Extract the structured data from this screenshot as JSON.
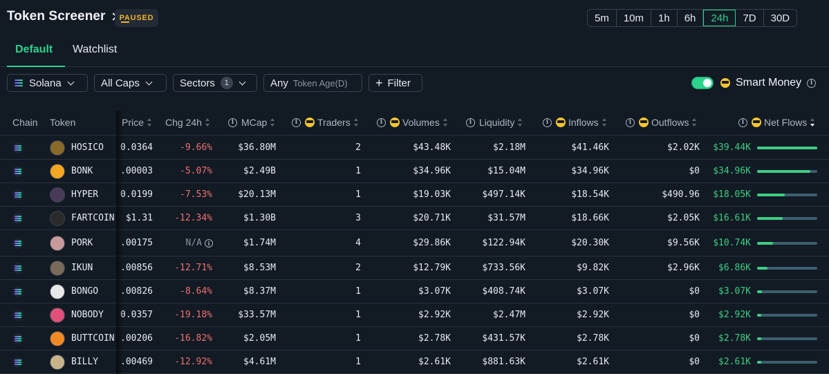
{
  "header": {
    "title": "Token Screener",
    "status_badge": "PAUSED"
  },
  "timeframes": [
    {
      "label": "5m",
      "active": false
    },
    {
      "label": "10m",
      "active": false
    },
    {
      "label": "1h",
      "active": false
    },
    {
      "label": "6h",
      "active": false
    },
    {
      "label": "24h",
      "active": true
    },
    {
      "label": "7D",
      "active": false
    },
    {
      "label": "30D",
      "active": false
    }
  ],
  "tabs": [
    {
      "label": "Default",
      "active": true
    },
    {
      "label": "Watchlist",
      "active": false
    }
  ],
  "filters": {
    "chain": "Solana",
    "caps": "All Caps",
    "sectors": "Sectors",
    "sectors_count": "1",
    "age_value": "Any",
    "age_label": "Token Age(D)",
    "filter": "Filter"
  },
  "smart_money": {
    "label": "Smart Money",
    "enabled": true
  },
  "columns": {
    "chain": "Chain",
    "token": "Token",
    "price": "Price",
    "chg": "Chg 24h",
    "mcap": "MCap",
    "traders": "Traders",
    "volumes": "Volumes",
    "liquidity": "Liquidity",
    "inflows": "Inflows",
    "outflows": "Outflows",
    "netflows": "Net Flows"
  },
  "colors": {
    "accent": "#2bd38d",
    "negative": "#f07171",
    "positive": "#3ecf83",
    "paused": "#f0b429"
  },
  "rows": [
    {
      "token": "HOSICO",
      "price": "0.0364",
      "chg": "-9.66%",
      "mcap": "$36.80M",
      "traders": "2",
      "volumes": "$43.48K",
      "liquidity": "$2.18M",
      "inflows": "$41.46K",
      "outflows": "$2.02K",
      "netflows": "$39.44K",
      "flow_share": 1.0,
      "avatar_color": "#8a6a2a"
    },
    {
      "token": "BONK",
      "price": ".00003",
      "chg": "-5.07%",
      "mcap": "$2.49B",
      "traders": "1",
      "volumes": "$34.96K",
      "liquidity": "$15.04M",
      "inflows": "$34.96K",
      "outflows": "$0",
      "netflows": "$34.96K",
      "flow_share": 0.89,
      "avatar_color": "#f5a623"
    },
    {
      "token": "HYPER",
      "price": "0.0199",
      "chg": "-7.53%",
      "mcap": "$20.13M",
      "traders": "1",
      "volumes": "$19.03K",
      "liquidity": "$497.14K",
      "inflows": "$18.54K",
      "outflows": "$490.96",
      "netflows": "$18.05K",
      "flow_share": 0.46,
      "avatar_color": "#4a3a5a"
    },
    {
      "token": "FARTCOIN",
      "price": "$1.31",
      "chg": "-12.34%",
      "mcap": "$1.30B",
      "traders": "3",
      "volumes": "$20.71K",
      "liquidity": "$31.57M",
      "inflows": "$18.66K",
      "outflows": "$2.05K",
      "netflows": "$16.61K",
      "flow_share": 0.42,
      "avatar_color": "#2a2a2a"
    },
    {
      "token": "PORK",
      "price": ".00175",
      "chg": "N/A",
      "mcap": "$1.74M",
      "traders": "4",
      "volumes": "$29.86K",
      "liquidity": "$122.94K",
      "inflows": "$20.30K",
      "outflows": "$9.56K",
      "netflows": "$10.74K",
      "flow_share": 0.27,
      "avatar_color": "#c89a9a"
    },
    {
      "token": "IKUN",
      "price": ".00856",
      "chg": "-12.71%",
      "mcap": "$8.53M",
      "traders": "2",
      "volumes": "$12.79K",
      "liquidity": "$733.56K",
      "inflows": "$9.82K",
      "outflows": "$2.96K",
      "netflows": "$6.86K",
      "flow_share": 0.17,
      "avatar_color": "#7a6a5a"
    },
    {
      "token": "BONGO",
      "price": ".00826",
      "chg": "-8.64%",
      "mcap": "$8.37M",
      "traders": "1",
      "volumes": "$3.07K",
      "liquidity": "$408.74K",
      "inflows": "$3.07K",
      "outflows": "$0",
      "netflows": "$3.07K",
      "flow_share": 0.08,
      "avatar_color": "#e8e8e8"
    },
    {
      "token": "NOBODY",
      "price": "0.0357",
      "chg": "-19.18%",
      "mcap": "$33.57M",
      "traders": "1",
      "volumes": "$2.92K",
      "liquidity": "$2.47M",
      "inflows": "$2.92K",
      "outflows": "$0",
      "netflows": "$2.92K",
      "flow_share": 0.07,
      "avatar_color": "#e0507a"
    },
    {
      "token": "BUTTCOIN",
      "price": ".00206",
      "chg": "-16.82%",
      "mcap": "$2.05M",
      "traders": "1",
      "volumes": "$2.78K",
      "liquidity": "$431.57K",
      "inflows": "$2.78K",
      "outflows": "$0",
      "netflows": "$2.78K",
      "flow_share": 0.07,
      "avatar_color": "#f08a24"
    },
    {
      "token": "BILLY",
      "price": ".00469",
      "chg": "-12.92%",
      "mcap": "$4.61M",
      "traders": "1",
      "volumes": "$2.61K",
      "liquidity": "$881.63K",
      "inflows": "$2.61K",
      "outflows": "$0",
      "netflows": "$2.61K",
      "flow_share": 0.07,
      "avatar_color": "#c8b48a"
    }
  ]
}
